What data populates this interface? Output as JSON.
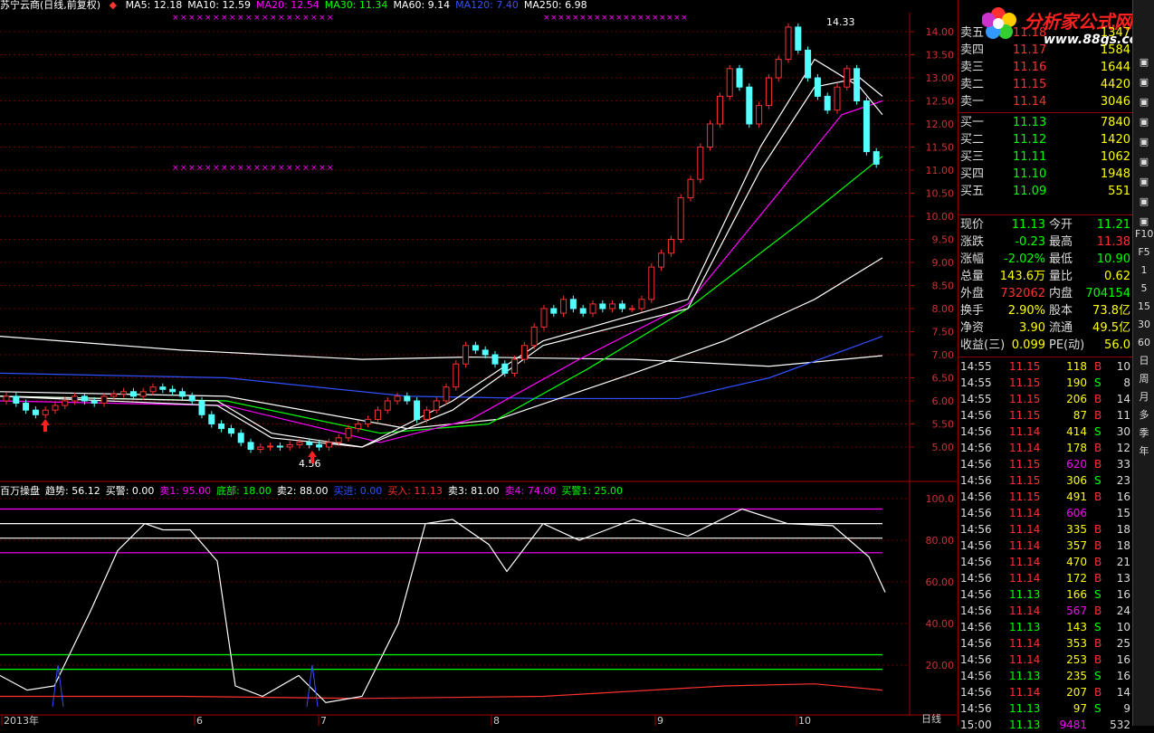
{
  "header": {
    "title": "苏宁云商(日线,前复权)",
    "ma": [
      {
        "label": "MA5: 12.18",
        "color": "#ffffff"
      },
      {
        "label": "MA10: 12.59",
        "color": "#ffffff"
      },
      {
        "label": "MA20: 12.54",
        "color": "#ff00ff"
      },
      {
        "label": "MA30: 11.34",
        "color": "#00ff00"
      },
      {
        "label": "MA60: 9.14",
        "color": "#ffffff"
      },
      {
        "label": "MA120: 7.40",
        "color": "#3050ff"
      },
      {
        "label": "MA250: 6.98",
        "color": "#ffffff"
      }
    ]
  },
  "price_labels": [
    "14.00",
    "13.50",
    "13.00",
    "12.50",
    "12.00",
    "11.50",
    "11.00",
    "10.50",
    "10.00",
    "9.50",
    "9.00",
    "8.50",
    "8.00",
    "7.50",
    "7.00",
    "6.50",
    "6.00",
    "5.50",
    "5.00"
  ],
  "annotations": {
    "high": "14.33",
    "low": "4.56"
  },
  "indicator": {
    "items": [
      {
        "label": "百万操盘",
        "color": "#ffffff"
      },
      {
        "label": "趋势: 56.12",
        "color": "#ffffff"
      },
      {
        "label": "买警: 0.00",
        "color": "#ffffff"
      },
      {
        "label": "卖1: 95.00",
        "color": "#ff00ff"
      },
      {
        "label": "底部: 18.00",
        "color": "#00ff00"
      },
      {
        "label": "卖2: 88.00",
        "color": "#ffffff"
      },
      {
        "label": "买进: 0.00",
        "color": "#3050ff"
      },
      {
        "label": "买入: 11.13",
        "color": "#ff3030"
      },
      {
        "label": "卖3: 81.00",
        "color": "#ffffff"
      },
      {
        "label": "卖4: 74.00",
        "color": "#ff00ff"
      },
      {
        "label": "买警1: 25.00",
        "color": "#00ff00"
      }
    ],
    "axis": [
      "100.0",
      "80.00",
      "60.00",
      "40.00",
      "20.00"
    ]
  },
  "date_axis": [
    "2013年",
    "6",
    "7",
    "8",
    "9",
    "10"
  ],
  "period_label": "日线",
  "logo": {
    "title": "分析家公式网",
    "url": "www.88gs.com"
  },
  "orderbook": {
    "sells": [
      {
        "label": "卖五",
        "price": "11.18",
        "vol": "1347"
      },
      {
        "label": "卖四",
        "price": "11.17",
        "vol": "1584"
      },
      {
        "label": "卖三",
        "price": "11.16",
        "vol": "1644"
      },
      {
        "label": "卖二",
        "price": "11.15",
        "vol": "4420"
      },
      {
        "label": "卖一",
        "price": "11.14",
        "vol": "3046"
      }
    ],
    "buys": [
      {
        "label": "买一",
        "price": "11.13",
        "vol": "7840"
      },
      {
        "label": "买二",
        "price": "11.12",
        "vol": "1420"
      },
      {
        "label": "买三",
        "price": "11.11",
        "vol": "1062"
      },
      {
        "label": "买四",
        "price": "11.10",
        "vol": "1948"
      },
      {
        "label": "买五",
        "price": "11.09",
        "vol": "551"
      }
    ]
  },
  "quote": [
    {
      "l1": "现价",
      "v1": "11.13",
      "c1": "#00ff00",
      "l2": "今开",
      "v2": "11.21",
      "c2": "#00ff00"
    },
    {
      "l1": "涨跌",
      "v1": "-0.23",
      "c1": "#00ff00",
      "l2": "最高",
      "v2": "11.38",
      "c2": "#ff3030"
    },
    {
      "l1": "涨幅",
      "v1": "-2.02%",
      "c1": "#00ff00",
      "l2": "最低",
      "v2": "10.90",
      "c2": "#00ff00"
    },
    {
      "l1": "总量",
      "v1": "143.6万",
      "c1": "#ffff00",
      "l2": "量比",
      "v2": "0.62",
      "c2": "#ffff00"
    },
    {
      "l1": "外盘",
      "v1": "732062",
      "c1": "#ff3030",
      "l2": "内盘",
      "v2": "704154",
      "c2": "#00ff00"
    },
    {
      "l1": "换手",
      "v1": "2.90%",
      "c1": "#ffff00",
      "l2": "股本",
      "v2": "73.8亿",
      "c2": "#ffff00"
    },
    {
      "l1": "净资",
      "v1": "3.90",
      "c1": "#ffff00",
      "l2": "流通",
      "v2": "49.5亿",
      "c2": "#ffff00"
    },
    {
      "l1": "收益(三)",
      "v1": "0.099",
      "c1": "#ffff00",
      "l2": "PE(动)",
      "v2": "56.0",
      "c2": "#ffff00"
    }
  ],
  "ticks": [
    {
      "t": "14:55",
      "p": "11.15",
      "v": "118",
      "s": "B",
      "n": "10"
    },
    {
      "t": "14:55",
      "p": "11.15",
      "v": "190",
      "s": "S",
      "n": "8"
    },
    {
      "t": "14:55",
      "p": "11.15",
      "v": "206",
      "s": "B",
      "n": "14"
    },
    {
      "t": "14:56",
      "p": "11.15",
      "v": "87",
      "s": "B",
      "n": "11"
    },
    {
      "t": "14:56",
      "p": "11.14",
      "v": "414",
      "s": "S",
      "n": "30"
    },
    {
      "t": "14:56",
      "p": "11.14",
      "v": "178",
      "s": "B",
      "n": "12"
    },
    {
      "t": "14:56",
      "p": "11.15",
      "v": "620",
      "s": "B",
      "n": "33"
    },
    {
      "t": "14:56",
      "p": "11.15",
      "v": "306",
      "s": "S",
      "n": "23"
    },
    {
      "t": "14:56",
      "p": "11.15",
      "v": "491",
      "s": "B",
      "n": "16"
    },
    {
      "t": "14:56",
      "p": "11.14",
      "v": "606",
      "s": "",
      "n": "15"
    },
    {
      "t": "14:56",
      "p": "11.14",
      "v": "335",
      "s": "B",
      "n": "18"
    },
    {
      "t": "14:56",
      "p": "11.14",
      "v": "357",
      "s": "B",
      "n": "18"
    },
    {
      "t": "14:56",
      "p": "11.14",
      "v": "470",
      "s": "B",
      "n": "21"
    },
    {
      "t": "14:56",
      "p": "11.14",
      "v": "172",
      "s": "B",
      "n": "13"
    },
    {
      "t": "14:56",
      "p": "11.13",
      "v": "166",
      "s": "S",
      "n": "16"
    },
    {
      "t": "14:56",
      "p": "11.14",
      "v": "567",
      "s": "B",
      "n": "24"
    },
    {
      "t": "14:56",
      "p": "11.13",
      "v": "143",
      "s": "S",
      "n": "10"
    },
    {
      "t": "14:56",
      "p": "11.14",
      "v": "353",
      "s": "B",
      "n": "25"
    },
    {
      "t": "14:56",
      "p": "11.14",
      "v": "253",
      "s": "B",
      "n": "16"
    },
    {
      "t": "14:56",
      "p": "11.13",
      "v": "235",
      "s": "S",
      "n": "16"
    },
    {
      "t": "14:56",
      "p": "11.14",
      "v": "207",
      "s": "B",
      "n": "14"
    },
    {
      "t": "14:56",
      "p": "11.13",
      "v": "97",
      "s": "S",
      "n": "9"
    },
    {
      "t": "15:00",
      "p": "11.13",
      "v": "9481",
      "s": "",
      "n": "532"
    }
  ],
  "toolbar": [
    "F10",
    "F5",
    "1",
    "5",
    "15",
    "30",
    "60",
    "日",
    "周",
    "月",
    "多",
    "季",
    "年"
  ]
}
